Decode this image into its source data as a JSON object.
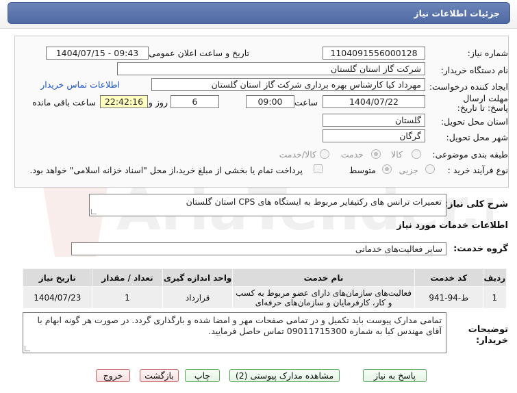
{
  "header": {
    "title": "جزئیات اطلاعات نیاز"
  },
  "form": {
    "need_number_label": "شماره نیاز:",
    "need_number": "1104091556000128",
    "announce_label": "تاریخ و ساعت اعلان عمومی:",
    "announce_value": "1404/07/15 - 09:43",
    "buyer_label": "نام دستگاه خریدار:",
    "buyer_value": "شرکت گاز استان گلستان",
    "creator_label": "ایجاد کننده درخواست:",
    "creator_value": "مهرداد کیا کارشناس بهره برداری شرکت گاز استان گلستان",
    "contact_link": "اطلاعات تماس خریدار",
    "deadline_label": "مهلت ارسال پاسخ: تا تاریخ:",
    "deadline_date": "1404/07/22",
    "time_label": "ساعت",
    "deadline_time": "09:00",
    "days_value": "6",
    "days_label": "روز و",
    "remaining_time": "22:42:16",
    "remaining_label": "ساعت باقی مانده",
    "province_label": "استان محل تحویل:",
    "province_value": "گلستان",
    "city_label": "شهر محل تحویل:",
    "city_value": "گرگان",
    "category_label": "طبقه بندی موضوعی:",
    "category_options": [
      "کالا",
      "خدمت",
      "کالا/خدمت"
    ],
    "category_selected": "خدمت",
    "process_label": "نوع فرآیند خرید :",
    "process_options": [
      "جزیی",
      "متوسط"
    ],
    "process_selected": "متوسط",
    "payment_note": "پرداخت تمام یا بخشی از مبلغ خرید،از محل \"اسناد خزانه اسلامی\" خواهد بود."
  },
  "summary": {
    "label": "شرح کلی نیاز:",
    "value": "تعمیرات ترانس های رکتیفایر مربوط به ایستگاه های CPS استان گلستان"
  },
  "services": {
    "section_title": "اطلاعات خدمات مورد نیاز",
    "group_label": "گروه خدمت:",
    "group_value": "سایر فعالیت‌های خدماتی",
    "columns": [
      "ردیف",
      "کد خدمت",
      "نام خدمت",
      "واحد اندازه گیری",
      "تعداد / مقدار",
      "تاریخ نیاز"
    ],
    "rows": [
      {
        "index": "1",
        "code": "ط-94-941",
        "name": "فعالیت‌های سازمان‌های دارای عضو مربوط به کسب و کار، کارفرمایان و سازمان‌های حرفه‌ای",
        "unit": "قرارداد",
        "qty": "1",
        "date": "1404/07/23"
      }
    ]
  },
  "notes": {
    "label": "توضیحات خریدار:",
    "value": "تمامی مدارک پیوست باید تکمیل و در تمامی صفحات مهر و امضا شده و بارگذاری گردد. در صورت هر گونه ابهام با آقای مهندس کیا به شماره 09011715300 تماس حاصل فرمایید."
  },
  "buttons": {
    "reply": "پاسخ به نیاز",
    "attachments": "مشاهده مدارک پیوستی (2)",
    "print": "چاپ",
    "back": "بازگشت",
    "exit": "خروج"
  },
  "watermark": {
    "text": "AriaTender.net"
  },
  "colors": {
    "title_bar": "#5a74ad",
    "accent_link": "#1a53c9",
    "field_highlight": "#ffffc0"
  }
}
